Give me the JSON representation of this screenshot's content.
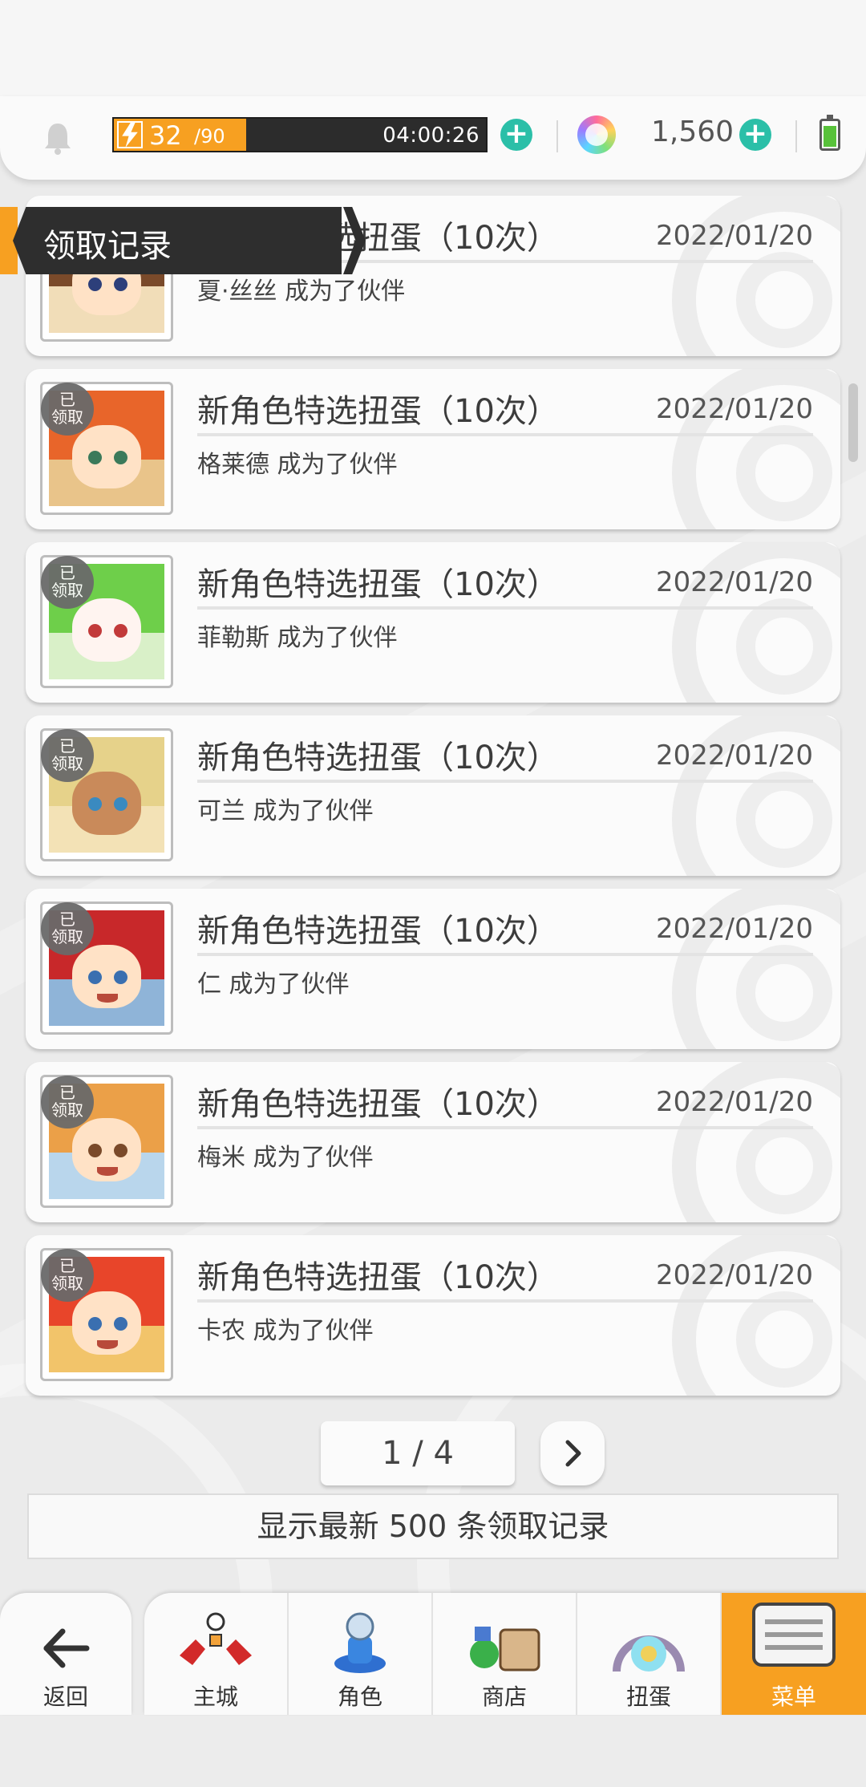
{
  "status_bar": {
    "stamina_current": "32",
    "stamina_max": "/90",
    "stamina_fraction": 0.356,
    "timer": "04:00:26",
    "gems": "1,560",
    "colors": {
      "stamina": "#f7a021",
      "plus": "#2bbfa8",
      "battery": "#58c23a"
    }
  },
  "header": {
    "title": "领取记录"
  },
  "records": [
    {
      "title": "新角色特选扭蛋（10次）",
      "date": "2022/01/20",
      "desc": "夏·丝丝 成为了伙伴",
      "badge": ""
    },
    {
      "title": "新角色特选扭蛋（10次）",
      "date": "2022/01/20",
      "desc": "格莱德 成为了伙伴",
      "badge": "已\n领取"
    },
    {
      "title": "新角色特选扭蛋（10次）",
      "date": "2022/01/20",
      "desc": "菲勒斯 成为了伙伴",
      "badge": "已\n领取"
    },
    {
      "title": "新角色特选扭蛋（10次）",
      "date": "2022/01/20",
      "desc": "可兰 成为了伙伴",
      "badge": "已\n领取"
    },
    {
      "title": "新角色特选扭蛋（10次）",
      "date": "2022/01/20",
      "desc": "仁 成为了伙伴",
      "badge": "已\n领取"
    },
    {
      "title": "新角色特选扭蛋（10次）",
      "date": "2022/01/20",
      "desc": "梅米 成为了伙伴",
      "badge": "已\n领取"
    },
    {
      "title": "新角色特选扭蛋（10次）",
      "date": "2022/01/20",
      "desc": "卡农 成为了伙伴",
      "badge": "已\n领取"
    }
  ],
  "pager": {
    "text": "1 / 4"
  },
  "notice": "显示最新 500 条领取记录",
  "nav": {
    "back": "返回",
    "items": [
      "主城",
      "角色",
      "商店",
      "扭蛋",
      "菜单"
    ],
    "active": "菜单"
  }
}
